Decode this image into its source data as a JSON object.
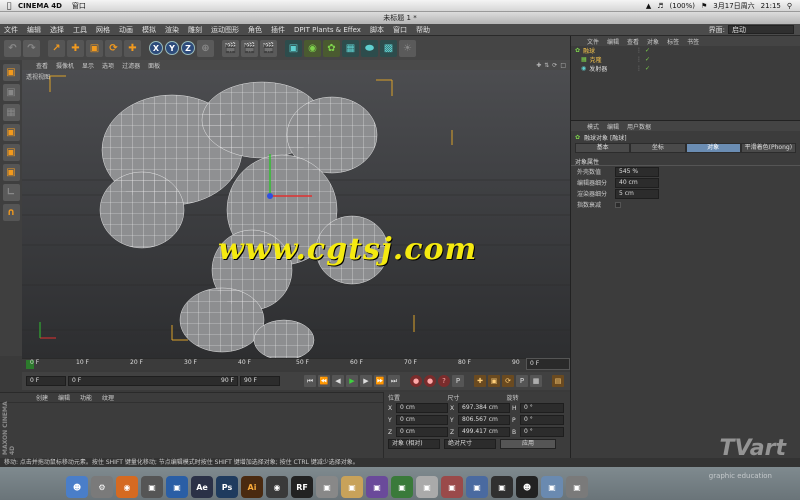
{
  "mac_menubar": {
    "app_name": "CINEMA 4D",
    "menu": "窗口",
    "battery": "(100%)",
    "date": "3月17日周六",
    "time": "21:15"
  },
  "window": {
    "title": "未标题 1 *"
  },
  "c4d_menu": {
    "items": [
      "文件",
      "编辑",
      "选择",
      "工具",
      "网格",
      "动画",
      "模拟",
      "渲染",
      "雕刻",
      "运动图形",
      "角色",
      "插件",
      "DPIT Plants & Effex",
      "脚本",
      "窗口",
      "帮助"
    ],
    "layout_label": "界面:",
    "layout_value": "启动"
  },
  "toolbar": {
    "axis_buttons": [
      "X",
      "Y",
      "Z"
    ]
  },
  "viewport": {
    "menu": [
      "查看",
      "摄像机",
      "显示",
      "选项",
      "过滤器",
      "面板"
    ],
    "label": "透视视图",
    "watermark": "www.cgtsj.com"
  },
  "timeline": {
    "ticks": [
      "0 F",
      "10 F",
      "20 F",
      "30 F",
      "40 F",
      "50 F",
      "60 F",
      "70 F",
      "80 F",
      "90"
    ],
    "end_field": "0 F"
  },
  "transport": {
    "current_frame": "0 F",
    "range_start": "0 F",
    "range_end": "90 F",
    "max_frame": "90 F"
  },
  "material_manager": {
    "menu": [
      "创建",
      "编辑",
      "功能",
      "纹理"
    ],
    "brand": "MAXON CINEMA 4D"
  },
  "coordinates": {
    "headers": [
      "位置",
      "尺寸",
      "旋转"
    ],
    "rows": [
      {
        "axis": "X",
        "pos": "0 cm",
        "size_axis": "X",
        "size": "697.384 cm",
        "rot_axis": "H",
        "rot": "0 °"
      },
      {
        "axis": "Y",
        "pos": "0 cm",
        "size_axis": "Y",
        "size": "806.567 cm",
        "rot_axis": "P",
        "rot": "0 °"
      },
      {
        "axis": "Z",
        "pos": "0 cm",
        "size_axis": "Z",
        "size": "499.417 cm",
        "rot_axis": "B",
        "rot": "0 °"
      }
    ],
    "mode": "对象 (相对)",
    "size_mode": "绝对尺寸",
    "apply": "应用"
  },
  "object_manager": {
    "menu": [
      "文件",
      "编辑",
      "查看",
      "对象",
      "标签",
      "书签"
    ],
    "objects": [
      "融球",
      "克隆",
      "发射器"
    ]
  },
  "attribute_manager": {
    "menu": [
      "模式",
      "编辑",
      "用户数据"
    ],
    "object_title": "融球对象 [融球]",
    "tabs": [
      "基本",
      "坐标",
      "对象",
      "平滑着色(Phong)"
    ],
    "active_tab": 2,
    "section": "对象属性",
    "props": [
      {
        "label": "外壳数值",
        "value": "545 %"
      },
      {
        "label": "编辑器细分",
        "value": "40 cm"
      },
      {
        "label": "渲染器细分",
        "value": "5 cm"
      },
      {
        "label": "指数衰减",
        "value": ""
      }
    ]
  },
  "status_bar": {
    "text": "移动: 点击并拖动鼠标移动元素。按住 SHIFT 键量化移动; 节点编辑模式时按住 SHIFT 键增加选择对象; 按住 CTRL 键减少选择对象。"
  },
  "brand_watermark": {
    "main": "TVart",
    "sub": "graphic education"
  },
  "colors": {
    "viewport_bg_top": "#4c4d50",
    "accent_orange": "#f29a1e",
    "watermark_yellow": "#f5ea10",
    "active_tab": "#6b8db3"
  }
}
